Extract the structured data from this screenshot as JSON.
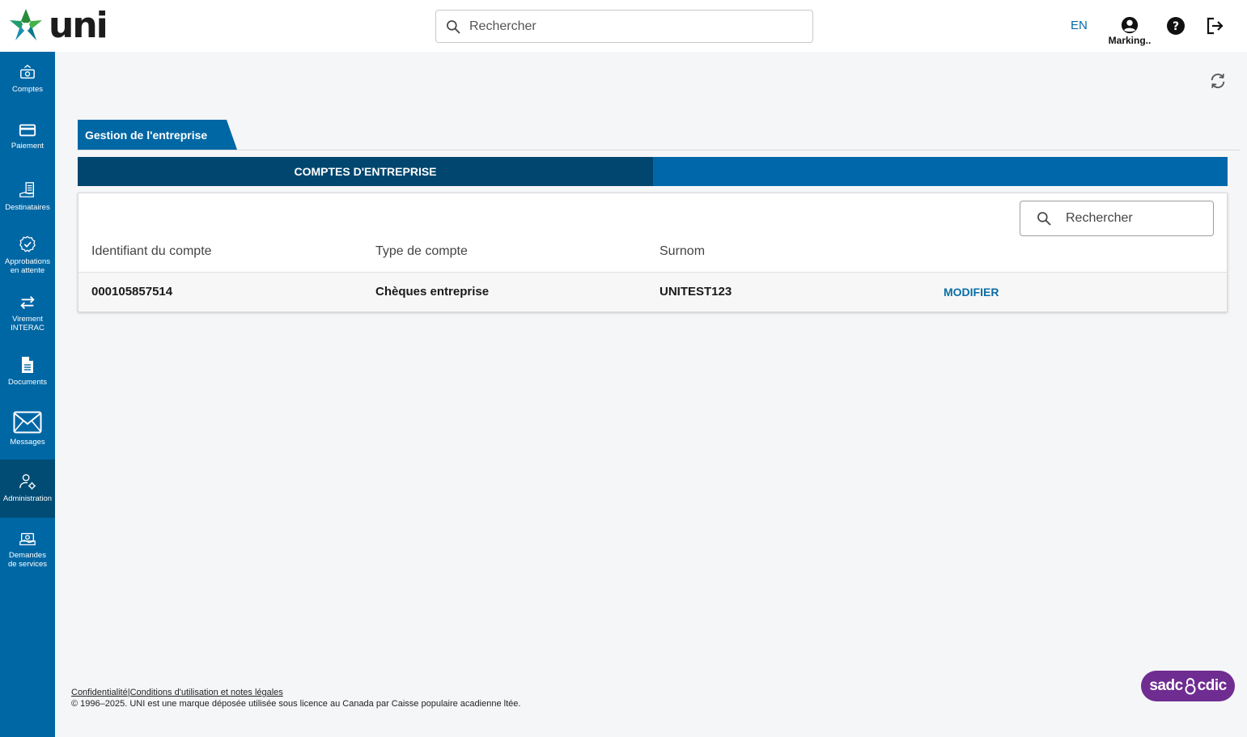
{
  "header": {
    "logo_text": "uni",
    "search_placeholder": "Rechercher",
    "language_toggle": "EN",
    "user_label": "Marking..",
    "help_icon": "help-circle-icon",
    "logout_icon": "logout-icon"
  },
  "sidebar": {
    "items": [
      {
        "label": "Comptes",
        "icon": "accounts-icon"
      },
      {
        "label": "Paiement",
        "icon": "credit-card-icon"
      },
      {
        "label": "Destinataires",
        "icon": "payees-icon"
      },
      {
        "label": "Approbations\nen attente",
        "icon": "approval-badge-icon"
      },
      {
        "label": "Virement\nINTERAC",
        "icon": "transfer-arrows-icon"
      },
      {
        "label": "Documents",
        "icon": "document-icon"
      },
      {
        "label": "Messages",
        "icon": "envelope-icon"
      },
      {
        "label": "Administration",
        "icon": "user-gear-icon",
        "active": true
      },
      {
        "label": "Demandes\nde services",
        "icon": "service-request-icon"
      }
    ]
  },
  "main": {
    "tab_label": "Gestion de l'entreprise",
    "section_title": "COMPTES D'ENTREPRISE",
    "table_search_placeholder": "Rechercher",
    "columns": [
      "Identifiant du compte",
      "Type de compte",
      "Surnom"
    ],
    "rows": [
      {
        "account_id": "000105857514",
        "account_type": "Chèques entreprise",
        "nickname": "UNITEST123",
        "action": "MODIFIER"
      }
    ]
  },
  "footer": {
    "privacy_link": "Confidentialité",
    "separator": "|",
    "terms_link": "Conditions d'utilisation et notes légales",
    "copyright": "© 1996–2025. UNI est une marque déposée utilisée sous licence au Canada par Caisse populaire acadienne ltée.",
    "cdic_left": "sadc",
    "cdic_right": "cdic"
  },
  "colors": {
    "primary_blue": "#0067a5",
    "dark_blue": "#00466e",
    "cdic_purple": "#6f2c91"
  }
}
